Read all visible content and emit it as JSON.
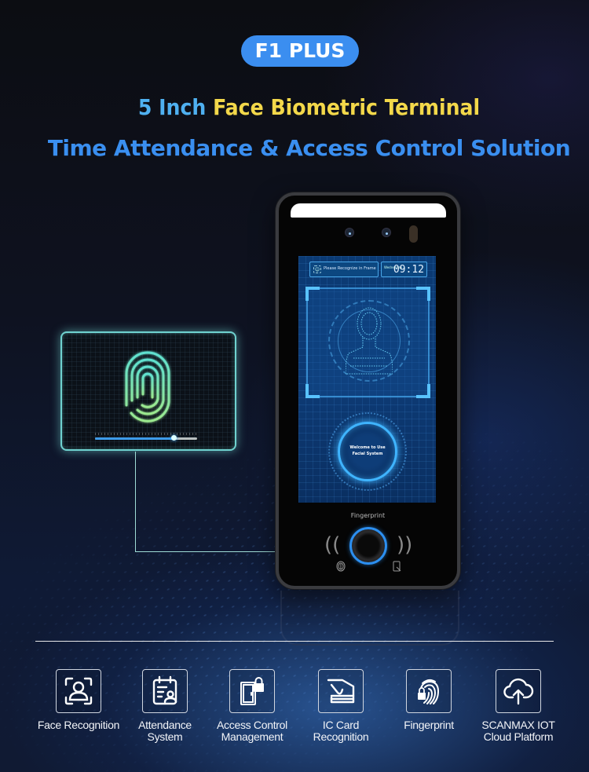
{
  "header": {
    "badge": "F1 PLUS",
    "title_line1_part1": "5 Inch ",
    "title_line1_part2": "Face Biometric Terminal",
    "title_line2": "Time Attendance & Access Control Solution"
  },
  "colors": {
    "badge_bg": "#3b8ef0",
    "title_blue_light": "#4fb0f0",
    "title_yellow": "#f3d84a",
    "title_blue": "#3a8ff0",
    "fingerprint_glow": "#6fd2cf",
    "sensor_ring": "#2c8ff0"
  },
  "device": {
    "screen": {
      "prompt": "Please Recognize in Frame",
      "day": "Wednesday",
      "time": "09:12",
      "welcome_line1": "Welcome to Use",
      "welcome_line2": "Facial System"
    },
    "fingerprint_label": "Fingerprint"
  },
  "fingerprint_card": {
    "scan_progress_percent": 77
  },
  "features": [
    {
      "icon": "face-scan-icon",
      "label_line1": "Face Recognition",
      "label_line2": ""
    },
    {
      "icon": "attendance-calendar-icon",
      "label_line1": "Attendance",
      "label_line2": "System"
    },
    {
      "icon": "door-lock-icon",
      "label_line1": "Access Control",
      "label_line2": "Management"
    },
    {
      "icon": "ic-card-icon",
      "label_line1": "IC Card",
      "label_line2": "Recognition"
    },
    {
      "icon": "fingerprint-lock-icon",
      "label_line1": "Fingerprint",
      "label_line2": ""
    },
    {
      "icon": "cloud-upload-icon",
      "label_line1": "SCANMAX IOT",
      "label_line2": "Cloud Platform"
    }
  ]
}
